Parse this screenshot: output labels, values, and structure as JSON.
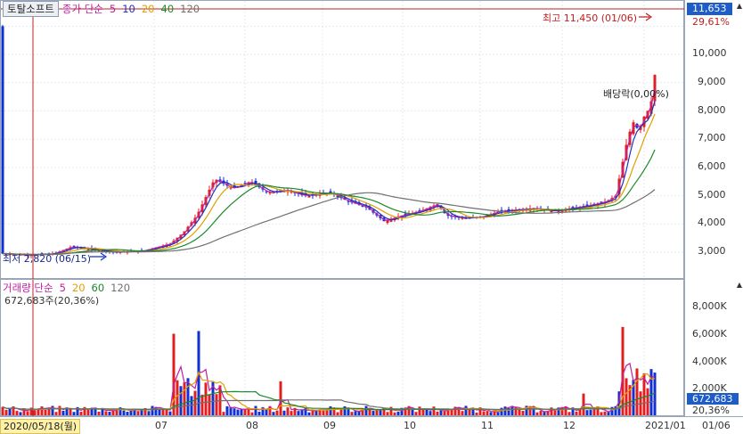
{
  "stock": {
    "name": "토탈소프트"
  },
  "price_legend": {
    "label": "종가 단순",
    "mas": [
      {
        "value": "5",
        "color": "#c020a0"
      },
      {
        "value": "10",
        "color": "#2030c0"
      },
      {
        "value": "20",
        "color": "#e0a000"
      },
      {
        "value": "40",
        "color": "#1a8a2a"
      },
      {
        "value": "120",
        "color": "#707070"
      }
    ]
  },
  "volume_legend": {
    "label": "거래량 단순",
    "mas": [
      {
        "value": "5",
        "color": "#c020a0"
      },
      {
        "value": "20",
        "color": "#e0a000"
      },
      {
        "value": "60",
        "color": "#1a8a2a"
      },
      {
        "value": "120",
        "color": "#707070"
      }
    ],
    "current": "672,683주(20,36%)"
  },
  "annotations": {
    "high": "최고 11,450 (01/06)",
    "low": "최저 2,820 (06/15)",
    "dividend": "배당락(0,00%)"
  },
  "price_axis": {
    "ticks": [
      "10,000",
      "9,000",
      "8,000",
      "7,000",
      "6,000",
      "5,000",
      "4,000",
      "3,000"
    ],
    "current_price": "11,653",
    "current_pct": "29,61%"
  },
  "volume_axis": {
    "ticks": [
      "8,000K",
      "6,000K",
      "4,000K",
      "2,000K"
    ],
    "current_volume": "672,683",
    "current_pct": "20,36%"
  },
  "x_axis": {
    "cursor_date": "2020/05/18(월)",
    "labels": [
      "07",
      "08",
      "09",
      "10",
      "11",
      "12",
      "2021/01",
      "01/06"
    ]
  },
  "colors": {
    "up": "#e02020",
    "down": "#1030d0",
    "cursor": "#c02020",
    "highlight": "#1e5cc8"
  },
  "icons": {
    "arrow": "triangle-arrow",
    "scroll": "scroll-arrow"
  }
}
